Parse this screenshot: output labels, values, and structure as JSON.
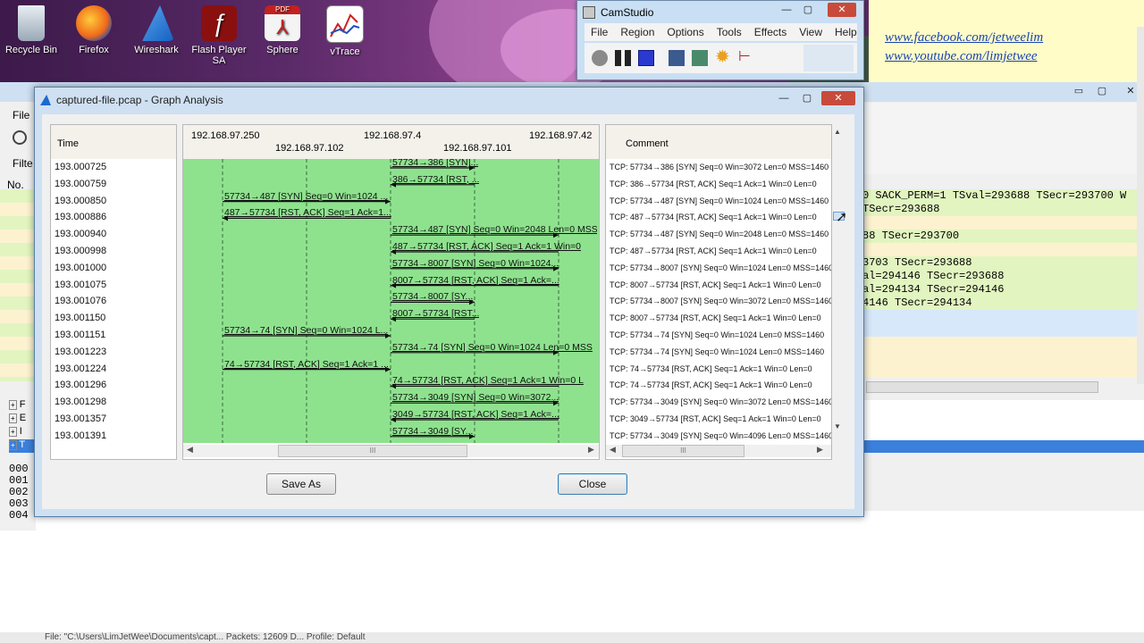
{
  "desktop": {
    "icons": [
      {
        "label": "Recycle Bin"
      },
      {
        "label": "Firefox"
      },
      {
        "label": "Wireshark"
      },
      {
        "label": "Flash Player SA"
      },
      {
        "label": "Sphere"
      },
      {
        "label": "vTrace"
      }
    ],
    "pdf_badge": "PDF"
  },
  "note": {
    "links": [
      "www.facebook.com/jetweelim",
      "www.youtube.com/limjetwee"
    ]
  },
  "camstudio": {
    "title": "CamStudio",
    "menu": [
      "File",
      "Region",
      "Options",
      "Tools",
      "Effects",
      "View",
      "Help"
    ]
  },
  "wireshark_bg": {
    "menu_file": "File",
    "filter_label": "Filte",
    "no_label": "No.",
    "tree_items": [
      "F",
      "E",
      "I",
      "T"
    ],
    "hex_offsets": [
      "000",
      "001",
      "002",
      "003",
      "004"
    ],
    "packet_lines": [
      "0 SACK_PERM=1 TSval=293688 TSecr=293700 W",
      " TSecr=293688",
      "",
      "88 TSecr=293700",
      "",
      "3703 TSecr=293688",
      "al=294146 TSecr=293688",
      "al=294134 TSecr=294146",
      "4146 TSecr=294134"
    ]
  },
  "dialog": {
    "title": "captured-file.pcap - Graph Analysis",
    "time_header": "Time",
    "comment_header": "Comment",
    "hosts": [
      "192.168.97.250",
      "192.168.97.102",
      "192.168.97.4",
      "192.168.97.101",
      "192.168.97.42"
    ],
    "times": [
      "193.000725",
      "193.000759",
      "193.000850",
      "193.000886",
      "193.000940",
      "193.000998",
      "193.001000",
      "193.001075",
      "193.001076",
      "193.001150",
      "193.001151",
      "193.001223",
      "193.001224",
      "193.001296",
      "193.001298",
      "193.001357",
      "193.001391"
    ],
    "arrows": [
      "57734→386 [SYN]...",
      "386→57734 [RST, ...",
      "57734→487 [SYN] Seq=0 Win=1024 ...",
      "487→57734 [RST, ACK] Seq=1 Ack=1...",
      "57734→487 [SYN] Seq=0 Win=2048 Len=0 MSS",
      "487→57734 [RST, ACK] Seq=1 Ack=1 Win=0",
      "57734→8007 [SYN] Seq=0 Win=1024...",
      "8007→57734 [RST, ACK] Seq=1 Ack=...",
      "57734→8007 [SY...",
      "8007→57734 [RST...",
      "57734→74 [SYN] Seq=0 Win=1024 L...",
      "57734→74 [SYN] Seq=0 Win=1024 Len=0 MSS",
      "74→57734 [RST, ACK] Seq=1 Ack=1 ...",
      "74→57734 [RST, ACK] Seq=1 Ack=1 Win=0 L",
      "57734→3049 [SYN] Seq=0 Win=3072...",
      "3049→57734 [RST, ACK] Seq=1 Ack=...",
      "57734→3049 [SY..."
    ],
    "comments": [
      "TCP: 57734→386 [SYN] Seq=0 Win=3072 Len=0 MSS=1460",
      "TCP: 386→57734 [RST, ACK] Seq=1 Ack=1 Win=0 Len=0",
      "TCP: 57734→487 [SYN] Seq=0 Win=1024 Len=0 MSS=1460",
      "TCP: 487→57734 [RST, ACK] Seq=1 Ack=1 Win=0 Len=0",
      "TCP: 57734→487 [SYN] Seq=0 Win=2048 Len=0 MSS=1460",
      "TCP: 487→57734 [RST, ACK] Seq=1 Ack=1 Win=0 Len=0",
      "TCP: 57734→8007 [SYN] Seq=0 Win=1024 Len=0 MSS=1460",
      "TCP: 8007→57734 [RST, ACK] Seq=1 Ack=1 Win=0 Len=0",
      "TCP: 57734→8007 [SYN] Seq=0 Win=3072 Len=0 MSS=1460",
      "TCP: 8007→57734 [RST, ACK] Seq=1 Ack=1 Win=0 Len=0",
      "TCP: 57734→74 [SYN] Seq=0 Win=1024 Len=0 MSS=1460",
      "TCP: 57734→74 [SYN] Seq=0 Win=1024 Len=0 MSS=1460",
      "TCP: 74→57734 [RST, ACK] Seq=1 Ack=1 Win=0 Len=0",
      "TCP: 74→57734 [RST, ACK] Seq=1 Ack=1 Win=0 Len=0",
      "TCP: 57734→3049 [SYN] Seq=0 Win=3072 Len=0 MSS=1460",
      "TCP: 3049→57734 [RST, ACK] Seq=1 Ack=1 Win=0 Len=0",
      "TCP: 57734→3049 [SYN] Seq=0 Win=4096 Len=0 MSS=1460"
    ],
    "save_as_label": "Save As",
    "close_label": "Close",
    "scroll_grip": "III"
  },
  "statusbar": {
    "text": "File: \"C:\\Users\\LimJetWee\\Documents\\capt...  Packets: 12609  D...  Profile: Default"
  },
  "colors": {
    "graph_green": "#8ee28e",
    "packet_green": "#e2f5c0",
    "packet_blue": "#d6e8fa",
    "packet_yellow": "#fdf2d0",
    "selected_row": "#3a80dc"
  }
}
